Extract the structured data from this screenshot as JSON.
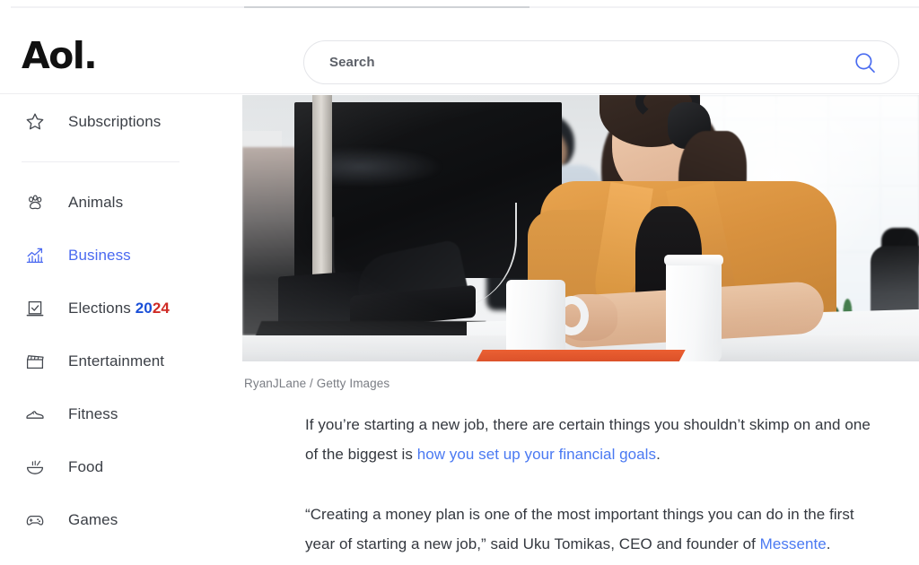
{
  "header": {
    "logo": "Aol.",
    "search": {
      "placeholder": "Search",
      "value": "",
      "icon": "search-icon",
      "icon_color": "#4a6cf0"
    }
  },
  "sidebar": {
    "groups": [
      {
        "items": [
          {
            "label": "Subscriptions",
            "icon": "star-icon",
            "active": false
          }
        ]
      },
      {
        "items": [
          {
            "label": "Animals",
            "icon": "paw-icon",
            "active": false
          },
          {
            "label": "Business",
            "icon": "bar-chart-arrow-icon",
            "active": true
          },
          {
            "label": "Elections",
            "icon": "ballot-check-icon",
            "active": false,
            "badge": {
              "first": "20",
              "second": "24",
              "first_color": "#1b50d8",
              "second_color": "#cf2b25"
            }
          },
          {
            "label": "Entertainment",
            "icon": "clapperboard-icon",
            "active": false
          },
          {
            "label": "Fitness",
            "icon": "sneaker-icon",
            "active": false
          },
          {
            "label": "Food",
            "icon": "bowl-icon",
            "active": false
          },
          {
            "label": "Games",
            "icon": "gamepad-icon",
            "active": false
          }
        ]
      }
    ],
    "active_color": "#4a69f0",
    "text_color": "#3b3f46"
  },
  "main": {
    "hero_image": {
      "alt": "Woman in orange jacket wearing headphones seated at an office desk with coffee cups and a monitor"
    },
    "caption": "RyanJLane / Getty Images",
    "paragraphs": [
      {
        "segments": [
          {
            "text": "If you’re starting a new job, there are certain things you shouldn’t skimp on and one",
            "link": false
          },
          {
            "text": "",
            "link": false
          }
        ],
        "lines": [
          [
            {
              "text": "If you’re starting a new job, there are certain things you shouldn’t skimp on and one",
              "link": false
            }
          ],
          [
            {
              "text": "of the biggest is ",
              "link": false
            },
            {
              "text": "how you set up your financial goals",
              "link": true
            },
            {
              "text": ".",
              "link": false
            }
          ]
        ]
      },
      {
        "lines": [
          [
            {
              "text": "“Creating a money plan is one of the most important things you can do in the first",
              "link": false
            }
          ],
          [
            {
              "text": "year of starting a new job,” said Uku Tomikas, CEO and founder of ",
              "link": false
            },
            {
              "text": "Messente",
              "link": true
            },
            {
              "text": ".",
              "link": false
            }
          ]
        ]
      }
    ],
    "link_color": "#4a79f2"
  }
}
